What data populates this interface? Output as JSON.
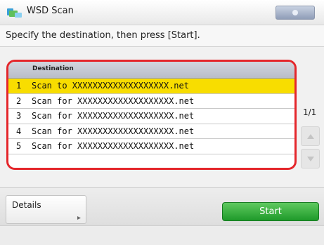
{
  "titlebar": {
    "title": "WSD Scan"
  },
  "instruction": "Specify the destination, then press [Start].",
  "list": {
    "header": "Destination",
    "rows": [
      {
        "num": "1",
        "dest": "Scan to XXXXXXXXXXXXXXXXXXX.net",
        "selected": true
      },
      {
        "num": "2",
        "dest": "Scan for XXXXXXXXXXXXXXXXXXX.net",
        "selected": false
      },
      {
        "num": "3",
        "dest": "Scan for XXXXXXXXXXXXXXXXXXX.net",
        "selected": false
      },
      {
        "num": "4",
        "dest": "Scan for XXXXXXXXXXXXXXXXXXX.net",
        "selected": false
      },
      {
        "num": "5",
        "dest": "Scan for XXXXXXXXXXXXXXXXXXX.net",
        "selected": false
      }
    ]
  },
  "pagination": {
    "page": "1/1"
  },
  "buttons": {
    "details": "Details",
    "start": "Start"
  },
  "icons": {
    "app": "scanner-network-icon",
    "scroll_up": "triangle-up-icon",
    "scroll_down": "triangle-down-icon",
    "details_arrow": "corner-arrow-icon"
  },
  "colors": {
    "highlight": "#e4262b",
    "selected_row": "#f8dd00",
    "start": "#1e9a2a"
  }
}
